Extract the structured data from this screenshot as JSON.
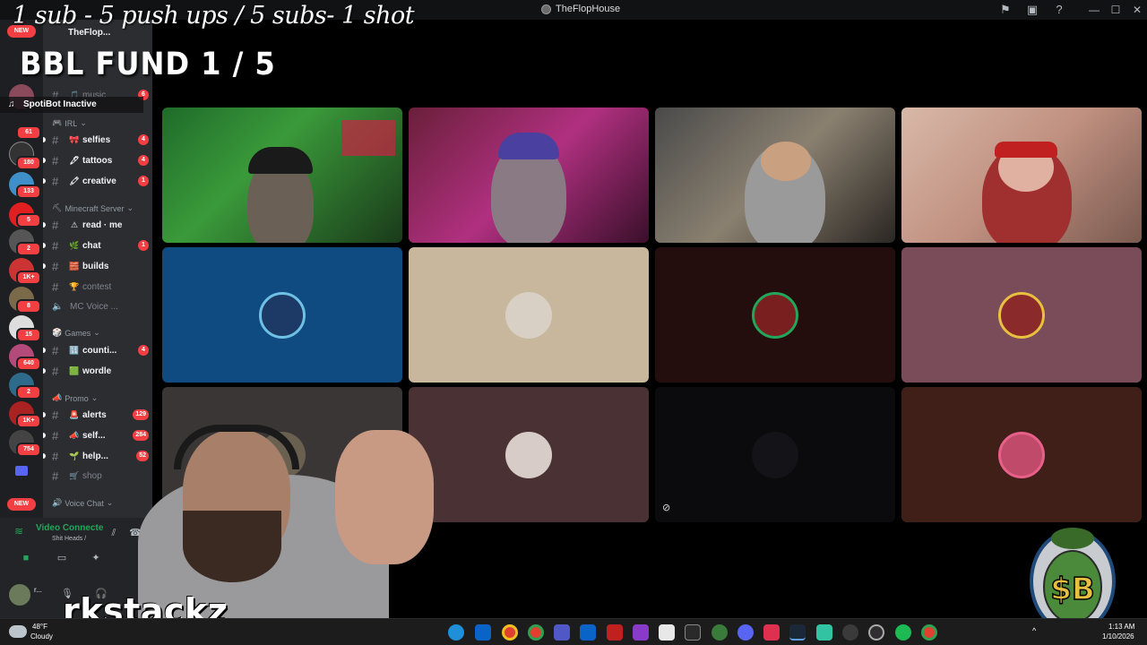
{
  "window": {
    "title": "TheFlopHouse"
  },
  "overlay": {
    "goal_text": "1 sub - 5 push ups / 5 subs- 1 shot",
    "fund_text": "BBL FUND  1 / 5",
    "spotibot": "SpotiBot Inactive",
    "streamer_name": "rkstackz"
  },
  "server_rail": {
    "new_top": "NEW",
    "new_bottom": "NEW",
    "badges": [
      "61",
      "180",
      "133",
      "5",
      "2",
      "1K+",
      "8",
      "15",
      "640",
      "2",
      "1K+",
      "754"
    ]
  },
  "sidebar": {
    "server_name": "TheFlop...",
    "categories": {
      "irl": "IRL",
      "minecraft": "Minecraft Server",
      "games": "Games",
      "promo": "Promo",
      "voice": "Voice Chat"
    },
    "channels": [
      {
        "name": "music",
        "emoji": "🎵",
        "badge": "6"
      },
      {
        "name": "selfies",
        "emoji": "🎀",
        "badge": "4"
      },
      {
        "name": "tattoos",
        "emoji": "🖋",
        "badge": "4"
      },
      {
        "name": "creative",
        "emoji": "🖍",
        "badge": "1"
      },
      {
        "name": "read · me",
        "emoji": "⚠",
        "badge": ""
      },
      {
        "name": "chat",
        "emoji": "🌿",
        "badge": "1"
      },
      {
        "name": "builds",
        "emoji": "🧱",
        "badge": ""
      },
      {
        "name": "contest",
        "emoji": "🏆",
        "badge": ""
      },
      {
        "name": "MC Voice ...",
        "emoji": "🔊",
        "badge": ""
      },
      {
        "name": "counti...",
        "emoji": "🔢",
        "badge": "4"
      },
      {
        "name": "wordle",
        "emoji": "🟩",
        "badge": ""
      },
      {
        "name": "alerts",
        "emoji": "🚨",
        "badge": "129"
      },
      {
        "name": "self...",
        "emoji": "📣",
        "badge": "284"
      },
      {
        "name": "help...",
        "emoji": "🌱",
        "badge": "52"
      },
      {
        "name": "shop",
        "emoji": "🛒",
        "badge": ""
      }
    ]
  },
  "voice": {
    "status": "Video Connecte",
    "channel": "Shit Heads /"
  },
  "user_panel": {
    "name": "r..."
  },
  "taskbar": {
    "weather_temp": "48°F",
    "weather_desc": "Cloudy",
    "time": "1:13 AM",
    "date": "1/10/2026"
  },
  "colors": {
    "speaking_ring": "#23a55a",
    "badge_red": "#f23f43",
    "tile_blue": "#0f4a80",
    "tile_beige": "#c9b79d",
    "tile_dark_red": "#230e0d",
    "tile_mauve": "#7a4b59",
    "tile_grey": "#3a3636",
    "tile_plum": "#4a3134",
    "tile_black": "#0b0b0e",
    "tile_brown": "#3f1f18"
  },
  "icons": {
    "titlebar": [
      "inbox-icon",
      "monitor-icon",
      "help-icon",
      "minimize-icon",
      "maximize-icon",
      "close-icon"
    ],
    "taskbar": [
      "edge-icon",
      "outlook-icon",
      "chrome-icon",
      "chrome-icon",
      "teams-icon",
      "outlook-icon",
      "app-icon",
      "app-icon",
      "store-icon",
      "app-icon",
      "app-icon",
      "discord-icon",
      "maps-icon",
      "steam-icon",
      "streamlabs-icon",
      "app-icon",
      "obs-icon",
      "spotify-icon",
      "chrome-icon"
    ]
  }
}
